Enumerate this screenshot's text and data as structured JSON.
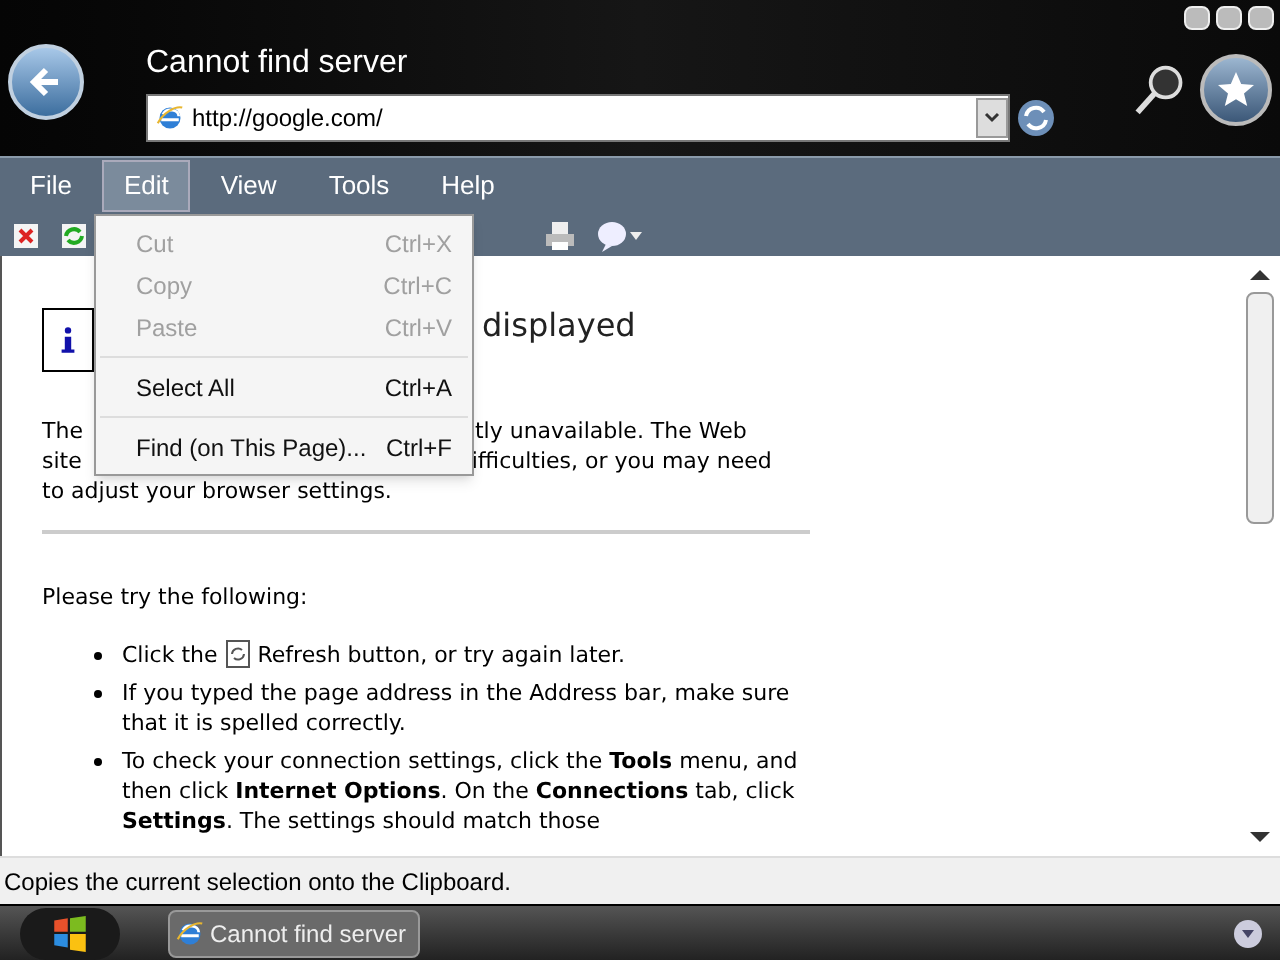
{
  "window": {
    "title": "Cannot find server",
    "address": "http://google.com/"
  },
  "menu_bar": [
    {
      "label": "File",
      "selected": false
    },
    {
      "label": "Edit",
      "selected": true
    },
    {
      "label": "View",
      "selected": false
    },
    {
      "label": "Tools",
      "selected": false
    },
    {
      "label": "Help",
      "selected": false
    }
  ],
  "edit_menu": [
    {
      "kind": "item",
      "label": "Cut",
      "shortcut": "Ctrl+X",
      "disabled": true
    },
    {
      "kind": "item",
      "label": "Copy",
      "shortcut": "Ctrl+C",
      "disabled": true
    },
    {
      "kind": "item",
      "label": "Paste",
      "shortcut": "Ctrl+V",
      "disabled": true
    },
    {
      "kind": "separator"
    },
    {
      "kind": "item",
      "label": "Select All",
      "shortcut": "Ctrl+A",
      "disabled": false
    },
    {
      "kind": "separator"
    },
    {
      "kind": "item",
      "label": "Find (on This Page)...",
      "shortcut": "Ctrl+F",
      "disabled": false
    }
  ],
  "page": {
    "heading_visible": "displayed",
    "intro_lines": [
      [
        "The",
        "tly unavailable. The Web"
      ],
      [
        "site",
        "ifficulties, or you may need"
      ],
      [
        "to adjust your browser settings."
      ]
    ],
    "try_heading": "Please try the following:",
    "bullets": [
      {
        "kind": "icon",
        "before": "Click the",
        "after": "Refresh button, or try again later."
      },
      {
        "kind": "text",
        "text": "If you typed the page address in the Address bar, make sure that it is spelled correctly."
      },
      {
        "kind": "text",
        "text": "To check your connection settings, click the **Tools** menu, and then click **Internet Options**. On the **Connections** tab, click **Settings**. The settings should match those"
      }
    ]
  },
  "status_bar": "Copies the current selection onto the Clipboard.",
  "taskbar": {
    "task": "Cannot find server"
  }
}
